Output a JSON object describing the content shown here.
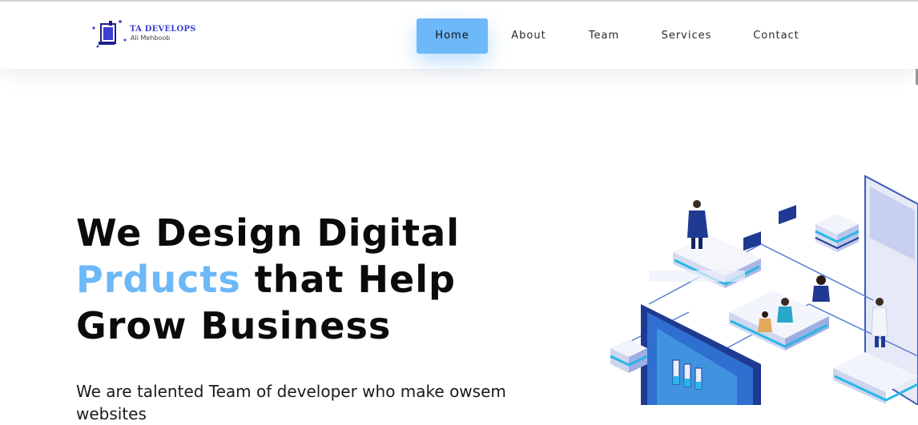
{
  "brand": {
    "title": "TA DEVELOPS",
    "subtitle": "Ali Mehboob"
  },
  "nav": {
    "items": [
      {
        "label": "Home",
        "active": true
      },
      {
        "label": "About"
      },
      {
        "label": "Team"
      },
      {
        "label": "Services"
      },
      {
        "label": "Contact"
      }
    ]
  },
  "hero": {
    "line1": "We Design Digital",
    "line2_accent": "Prducts",
    "line2_rest": " that Help",
    "line3": "Grow Business",
    "description": "We are talented Team of developer who make owsem websites"
  },
  "colors": {
    "accent": "#6cb8f8",
    "brand": "#3b3fd2"
  }
}
